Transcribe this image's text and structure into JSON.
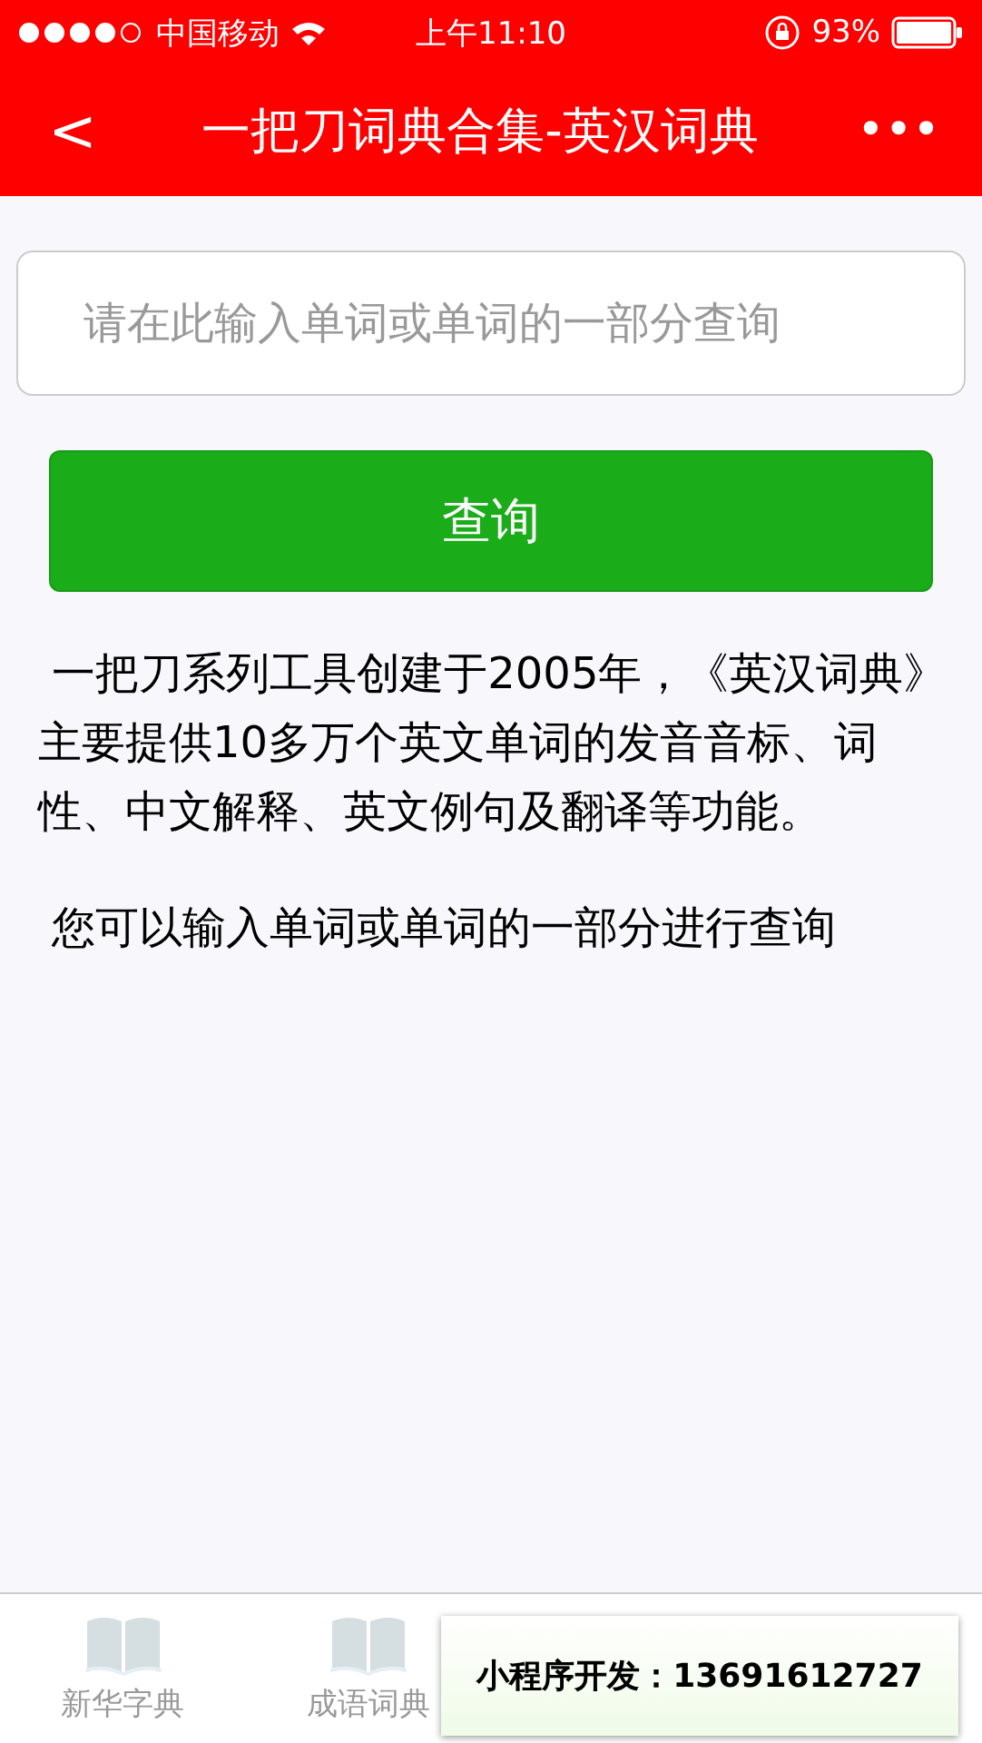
{
  "status_bar": {
    "carrier": "中国移动",
    "time": "上午11:10",
    "battery": "93%"
  },
  "nav": {
    "back": "<",
    "title": "一把刀词典合集-英汉词典",
    "more": "•••"
  },
  "search": {
    "placeholder": "请在此输入单词或单词的一部分查询"
  },
  "button": "查询",
  "paragraphs": [
    " 一把刀系列工具创建于2005年，《英汉词典》主要提供10多万个英文单词的发音音标、词性、中文解释、英文例句及翻译等功能。",
    " 您可以输入单词或单词的一部分进行查询"
  ],
  "tabs": [
    {
      "label": "新华字典",
      "selected": false
    },
    {
      "label": "成语词典",
      "selected": false
    }
  ],
  "promo_banner": "小程序开发：13691612727"
}
